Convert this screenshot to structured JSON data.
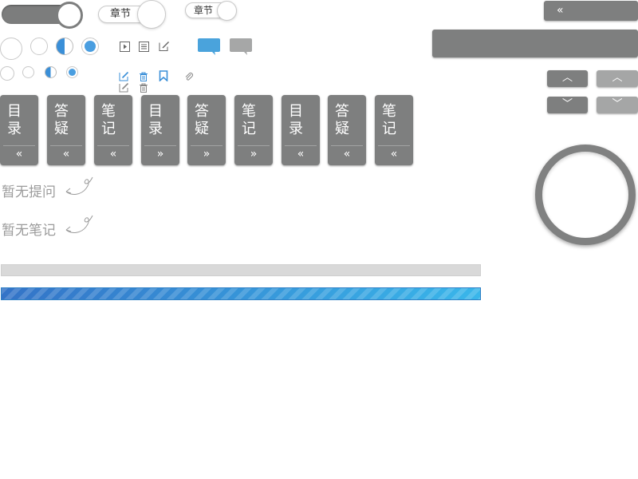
{
  "chapter_pill_large": {
    "label": "章节"
  },
  "chapter_pill_small": {
    "label": "章节"
  },
  "tabs": [
    {
      "line1": "目",
      "line2": "录",
      "arrow": "«"
    },
    {
      "line1": "答",
      "line2": "疑",
      "arrow": "«"
    },
    {
      "line1": "笔",
      "line2": "记",
      "arrow": "«"
    },
    {
      "line1": "目",
      "line2": "录",
      "arrow": "»"
    },
    {
      "line1": "答",
      "line2": "疑",
      "arrow": "»"
    },
    {
      "line1": "笔",
      "line2": "记",
      "arrow": "»"
    },
    {
      "line1": "目",
      "line2": "录",
      "arrow": "«"
    },
    {
      "line1": "答",
      "line2": "疑",
      "arrow": "«"
    },
    {
      "line1": "笔",
      "line2": "记",
      "arrow": "«"
    }
  ],
  "empty_states": {
    "no_questions": "暂无提问",
    "no_notes": "暂无笔记"
  },
  "collapse_button": {
    "arrow": "«"
  },
  "arrows": {
    "up": "︿",
    "down": "﹀"
  },
  "colors": {
    "accent_blue": "#3a8fd8",
    "panel_gray": "#7e7f7f",
    "light_gray": "#a5a6a6"
  },
  "icons": [
    "toggle-switch",
    "play-icon",
    "document-icon",
    "edit-icon",
    "comment-icon",
    "delete-icon",
    "bookmark-icon",
    "attachment-icon",
    "ring-progress"
  ]
}
